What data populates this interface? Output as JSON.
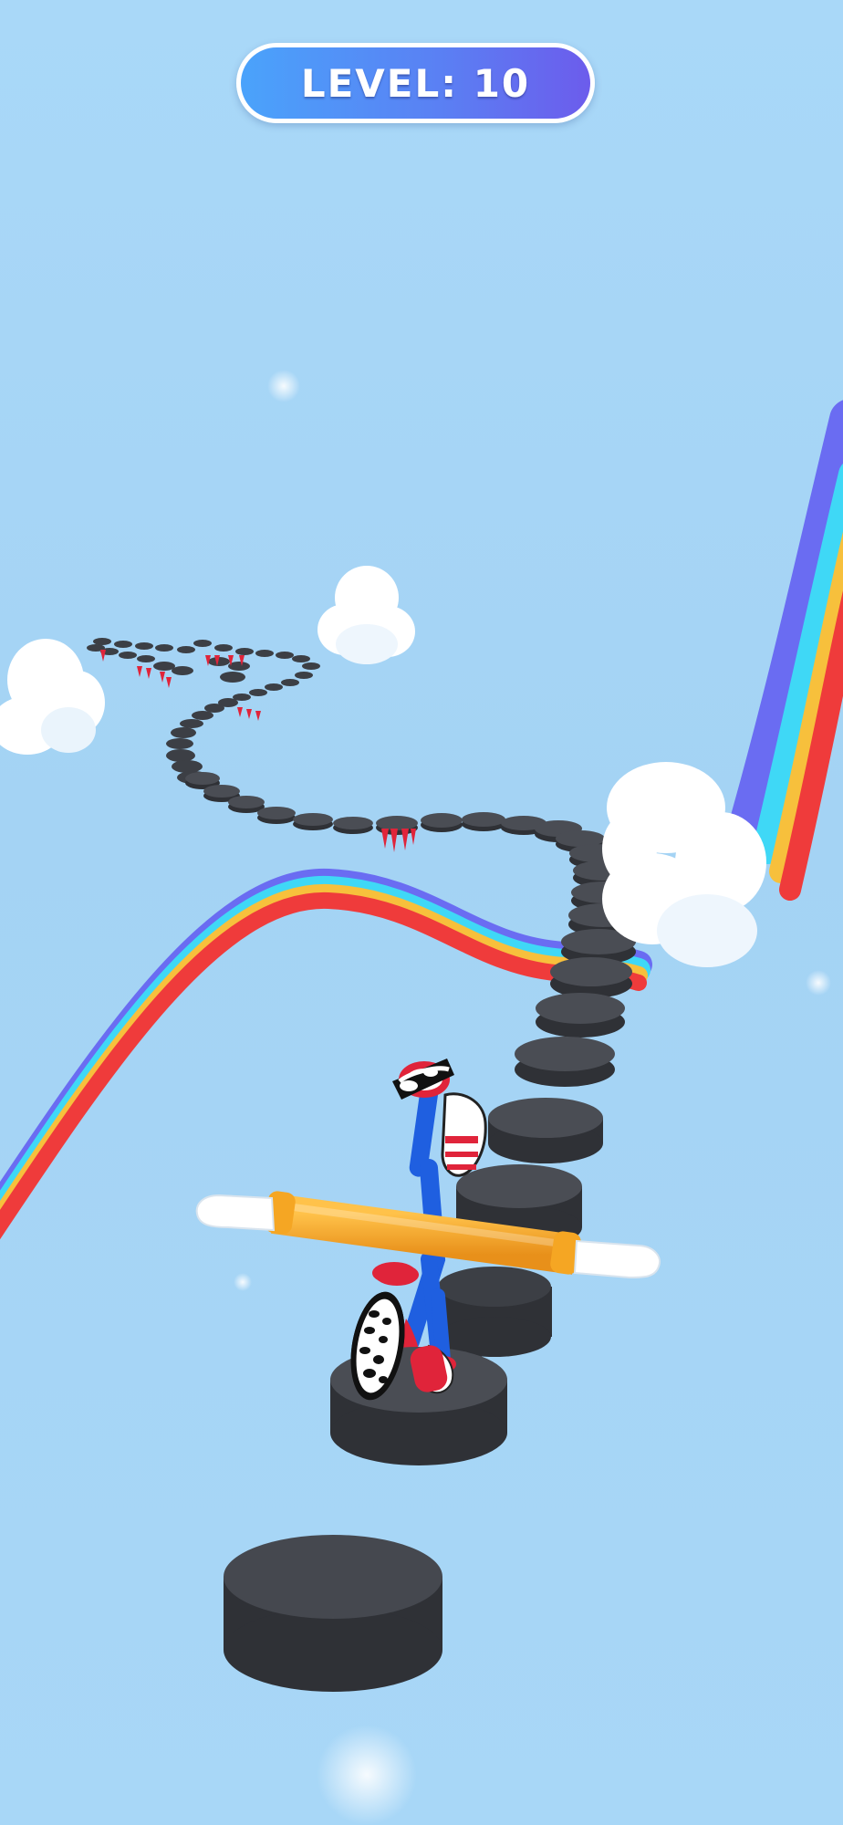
{
  "hud": {
    "level_prefix": "LEVEL:",
    "level_number": "10"
  },
  "colors": {
    "sky": "#a8d7f7",
    "platform_top": "#4a4d54",
    "platform_side": "#2f3136",
    "spikes": "#e0243a",
    "pole": "#f5a623",
    "body_blue": "#1f5fe0",
    "shoe_red": "#e0243a",
    "hud_gradient_start": "#4aa3fb",
    "hud_gradient_end": "#6c5cec"
  },
  "rainbow_colors": [
    "#ef3b3b",
    "#f7c03c",
    "#3fd8f6",
    "#6a6cf2"
  ],
  "scene": {
    "objects": [
      "rainbow-track-right",
      "rainbow-track-left",
      "stepping-stone-path",
      "spike-traps",
      "clouds",
      "stickman-runner",
      "balance-pole"
    ]
  }
}
